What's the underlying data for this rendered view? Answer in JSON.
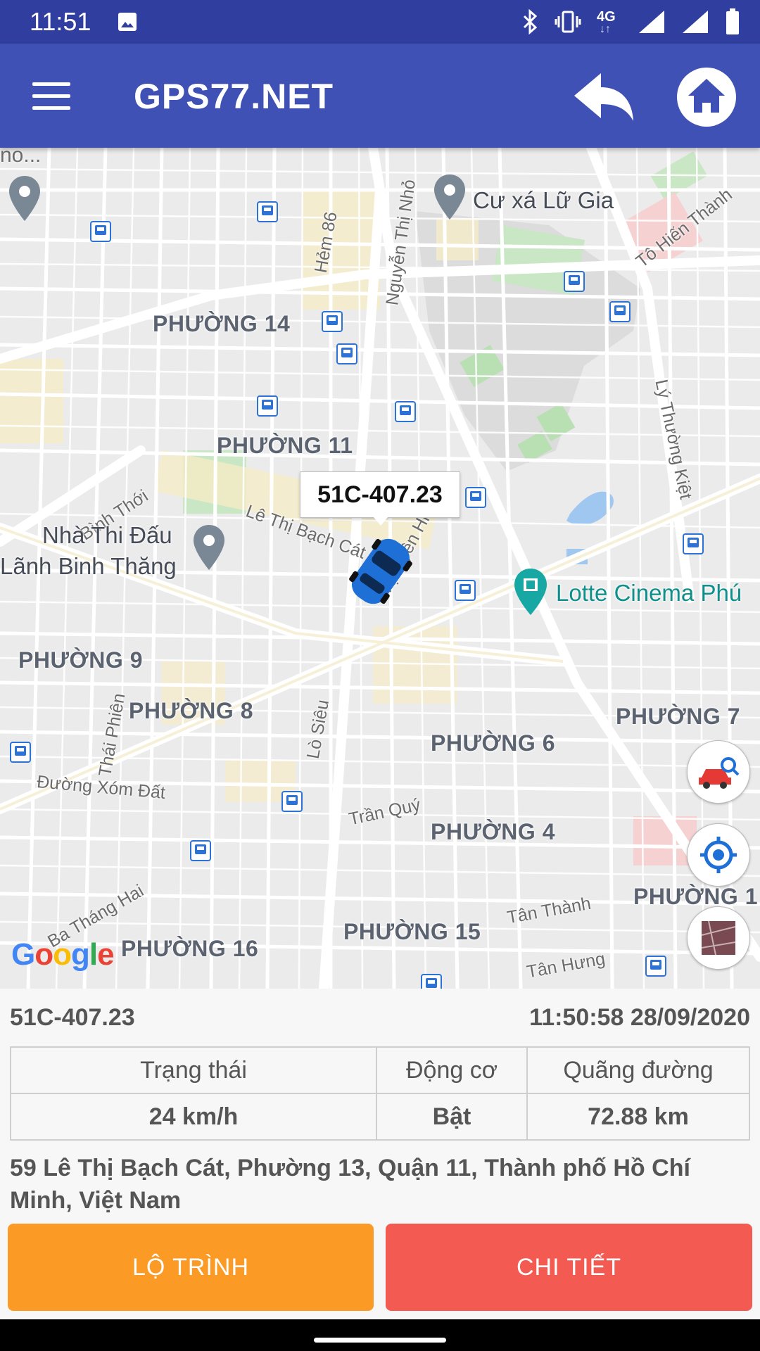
{
  "status_bar": {
    "time": "11:51",
    "network": "4G"
  },
  "app_bar": {
    "title": "GPS77.NET"
  },
  "map": {
    "vehicle_label": "51C-407.23",
    "wards": [
      "PHƯỜNG 14",
      "PHƯỜNG 11",
      "PHƯỜNG 9",
      "PHƯỜNG 8",
      "PHƯỜNG 6",
      "PHƯỜNG 7",
      "PHƯỜNG 4",
      "PHƯỜNG 1",
      "PHƯỜNG 15",
      "PHƯỜNG 16"
    ],
    "streets": [
      "Hẻm 86",
      "Nguyễn Thị Nhỏ",
      "Tô Hiến Thành",
      "Lý Thường Kiệt",
      "Bình Thới",
      "Lê Thị Bạch Cát",
      "Tạ Uyên Hiệp",
      "Thái Phiên",
      "Lò Siêu",
      "Đường Xóm Đất",
      "Trần Quý",
      "Ba Tháng Hai",
      "Tân Thành",
      "Tân Hưng",
      "no..."
    ],
    "pois": {
      "cu_xa": "Cư xá Lữ Gia",
      "stadium_line1": "Nhà Thi Đấu",
      "stadium_line2": "Lãnh Binh Thăng",
      "cinema": "Lotte Cinema Phú"
    },
    "attribution": "Google"
  },
  "info": {
    "plate": "51C-407.23",
    "timestamp": "11:50:58 28/09/2020",
    "headers": {
      "status": "Trạng thái",
      "engine": "Động cơ",
      "distance": "Quãng đường"
    },
    "values": {
      "status": "24 km/h",
      "engine": "Bật",
      "distance": "72.88 km"
    },
    "address": "59 Lê Thị Bạch Cát, Phường 13, Quận 11, Thành phố Hồ Chí Minh, Việt Nam"
  },
  "buttons": {
    "route": "LỘ TRÌNH",
    "detail": "CHI TIẾT"
  },
  "colors": {
    "app_bar": "#3f51b5",
    "status_bar": "#303f9f",
    "route_button": "#fb9a25",
    "detail_button": "#f35a52"
  }
}
